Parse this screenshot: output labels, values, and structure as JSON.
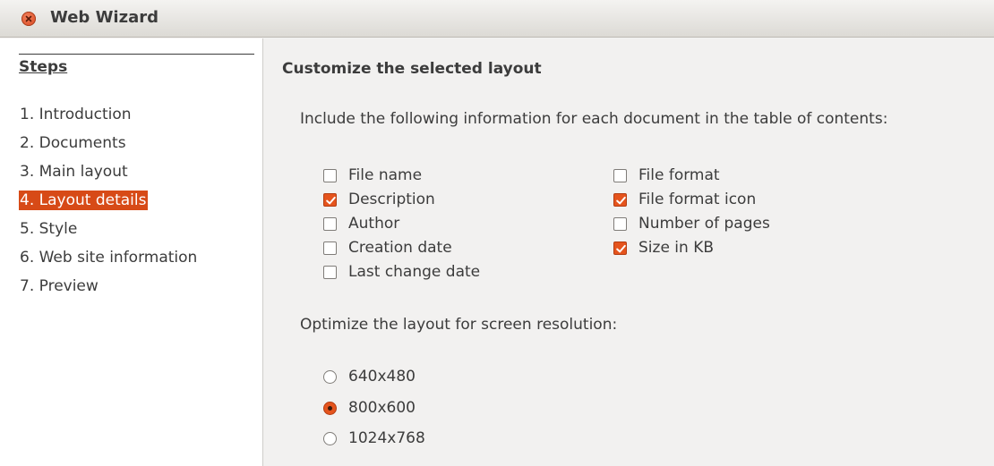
{
  "window": {
    "title": "Web Wizard",
    "accent": "#d74a17"
  },
  "sidebar": {
    "heading": "Steps",
    "items": [
      {
        "label": "1. Introduction"
      },
      {
        "label": "2. Documents"
      },
      {
        "label": "3. Main layout"
      },
      {
        "label": "4. Layout details",
        "selected": true
      },
      {
        "label": "5. Style"
      },
      {
        "label": "6. Web site information"
      },
      {
        "label": "7. Preview"
      }
    ]
  },
  "main": {
    "title": "Customize the selected layout",
    "info_prompt": "Include the following information for each document in the table of contents:",
    "info_left": [
      {
        "label": "File name",
        "checked": false
      },
      {
        "label": "Description",
        "checked": true
      },
      {
        "label": "Author",
        "checked": false
      },
      {
        "label": "Creation date",
        "checked": false
      },
      {
        "label": "Last change date",
        "checked": false
      }
    ],
    "info_right": [
      {
        "label": "File format",
        "checked": false
      },
      {
        "label": "File format icon",
        "checked": true
      },
      {
        "label": "Number of pages",
        "checked": false
      },
      {
        "label": "Size in KB",
        "checked": true
      }
    ],
    "resolution_prompt": "Optimize the layout for screen resolution:",
    "resolutions": [
      {
        "label": "640x480",
        "selected": false
      },
      {
        "label": "800x600",
        "selected": true
      },
      {
        "label": "1024x768",
        "selected": false
      }
    ]
  }
}
